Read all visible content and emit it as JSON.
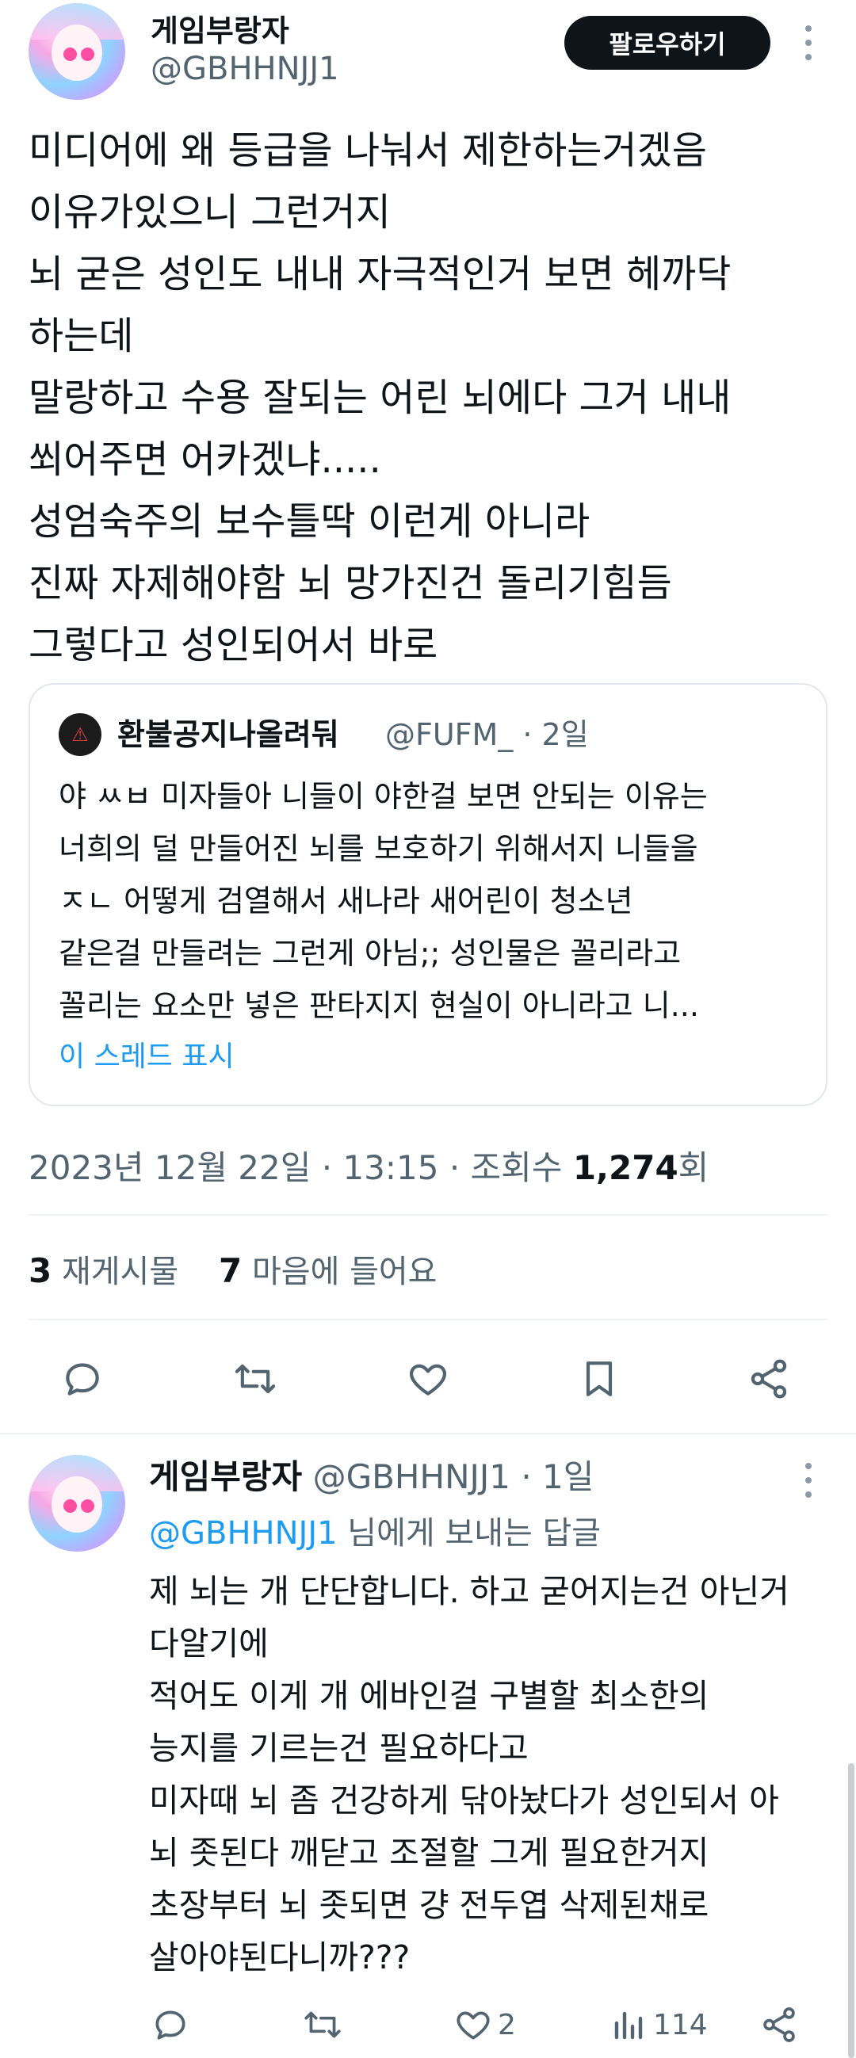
{
  "main_tweet": {
    "author_name": "게임부랑자",
    "author_handle": "@GBHHNJJ1",
    "follow_label": "팔로우하기",
    "lines": [
      "미디어에 왜 등급을 나눠서 제한하는거겠음",
      "이유가있으니 그런거지",
      "뇌 굳은 성인도 내내 자극적인거 보면 헤까닥",
      "하는데",
      "말랑하고 수용 잘되는 어린 뇌에다 그거 내내",
      "쐬어주면 어카겠냐.....",
      "성엄숙주의 보수틀딱 이런게 아니라",
      "진짜 자제해야함 뇌 망가진건 돌리기힘듬",
      "그렇다고 성인되어서 바로"
    ]
  },
  "quote": {
    "author_name": "환불공지나올려둬",
    "author_handle": "@FUFM_ · 2일",
    "lines": [
      "야 ㅆㅂ 미자들아 니들이 야한걸 보면 안되는 이유는",
      "너희의 덜 만들어진 뇌를 보호하기 위해서지 니들을",
      "ㅈㄴ 어떻게 검열해서 새나라 새어린이 청소년",
      "같은걸 만들려는 그런게 아님;; 성인물은 꼴리라고",
      "꼴리는 요소만 넣은 판타지지 현실이 아니라고 니..."
    ],
    "show_thread": "이 스레드 표시"
  },
  "meta": {
    "datetime": "2023년 12월 22일 · 13:15 · 조회수 ",
    "views": "1,274",
    "views_suffix": "회"
  },
  "stats": {
    "retweets": "3",
    "retweets_label": "재게시물",
    "likes": "7",
    "likes_label": "마음에 들어요"
  },
  "reply": {
    "author_name": "게임부랑자",
    "author_handle": "@GBHHNJJ1 · 1일",
    "reply_to_mention": "@GBHHNJJ1",
    "reply_to_suffix": " 님에게 보내는 답글",
    "lines": [
      "제 뇌는 개 단단합니다. 하고 굳어지는건 아닌거",
      "다알기에",
      "적어도 이게 개 에바인걸 구별할 최소한의",
      "능지를 기르는건 필요하다고",
      "미자때 뇌 좀 건강하게 닦아놨다가 성인되서 아",
      "뇌 좃된다 깨닫고 조절할 그게 필요한거지",
      "초장부터 뇌 좃되면 걍 전두엽 삭제된채로",
      "살아야된다니까???"
    ],
    "like_count": "2",
    "view_count": "114"
  },
  "colors": {
    "text": "#0f1419",
    "secondary": "#536471",
    "link": "#1d9bf0",
    "divider": "#eff3f4"
  }
}
